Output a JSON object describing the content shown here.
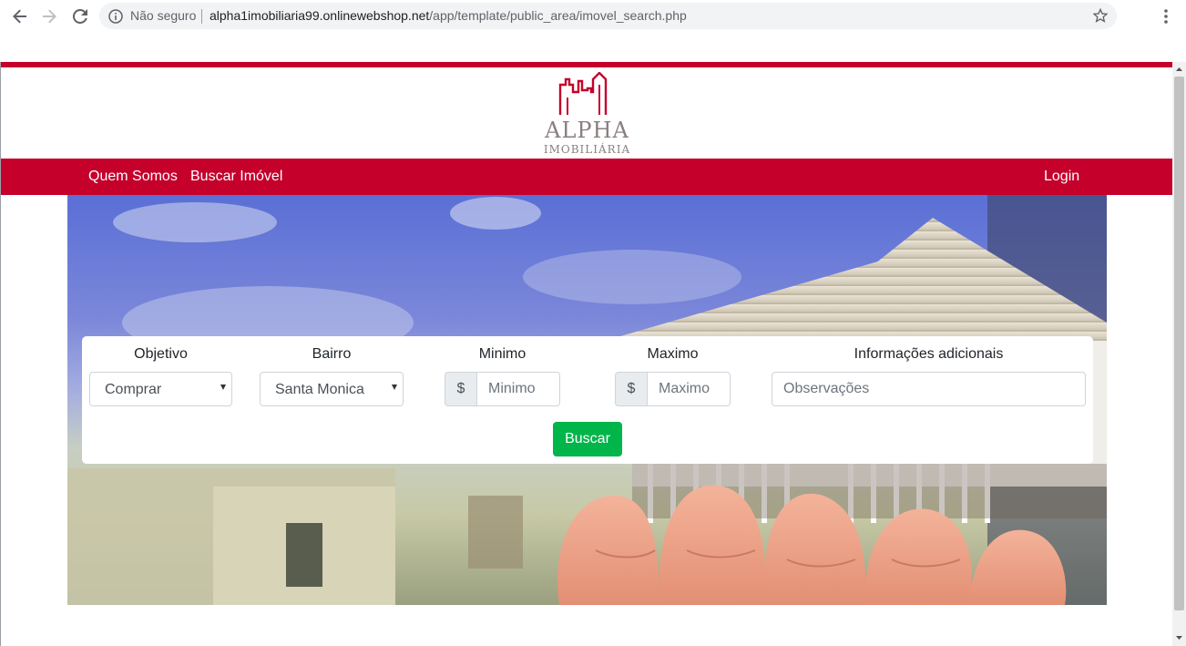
{
  "browser": {
    "security_label": "Não seguro",
    "url_host": "alpha1imobiliaria99.onlinewebshop.net",
    "url_path": "/app/template/public_area/imovel_search.php",
    "icons": [
      "back-arrow-icon",
      "forward-arrow-icon",
      "reload-icon",
      "info-icon",
      "star-icon",
      "menu-dots-icon"
    ]
  },
  "brand": {
    "name": "ALPHA",
    "subtitle": "IMOBILIÁRIA",
    "accent_color": "#c4002b"
  },
  "navbar": {
    "links": [
      "Quem Somos",
      "Buscar Imóvel"
    ],
    "login": "Login"
  },
  "search": {
    "objetivo": {
      "label": "Objetivo",
      "value": "Comprar"
    },
    "bairro": {
      "label": "Bairro",
      "value": "Santa Monica"
    },
    "minimo": {
      "label": "Minimo",
      "addon": "$",
      "placeholder": "Minimo"
    },
    "maximo": {
      "label": "Maximo",
      "addon": "$",
      "placeholder": "Maximo"
    },
    "info": {
      "label": "Informações adicionais",
      "placeholder": "Observações"
    },
    "submit_label": "Buscar",
    "submit_color": "#00b54a"
  }
}
